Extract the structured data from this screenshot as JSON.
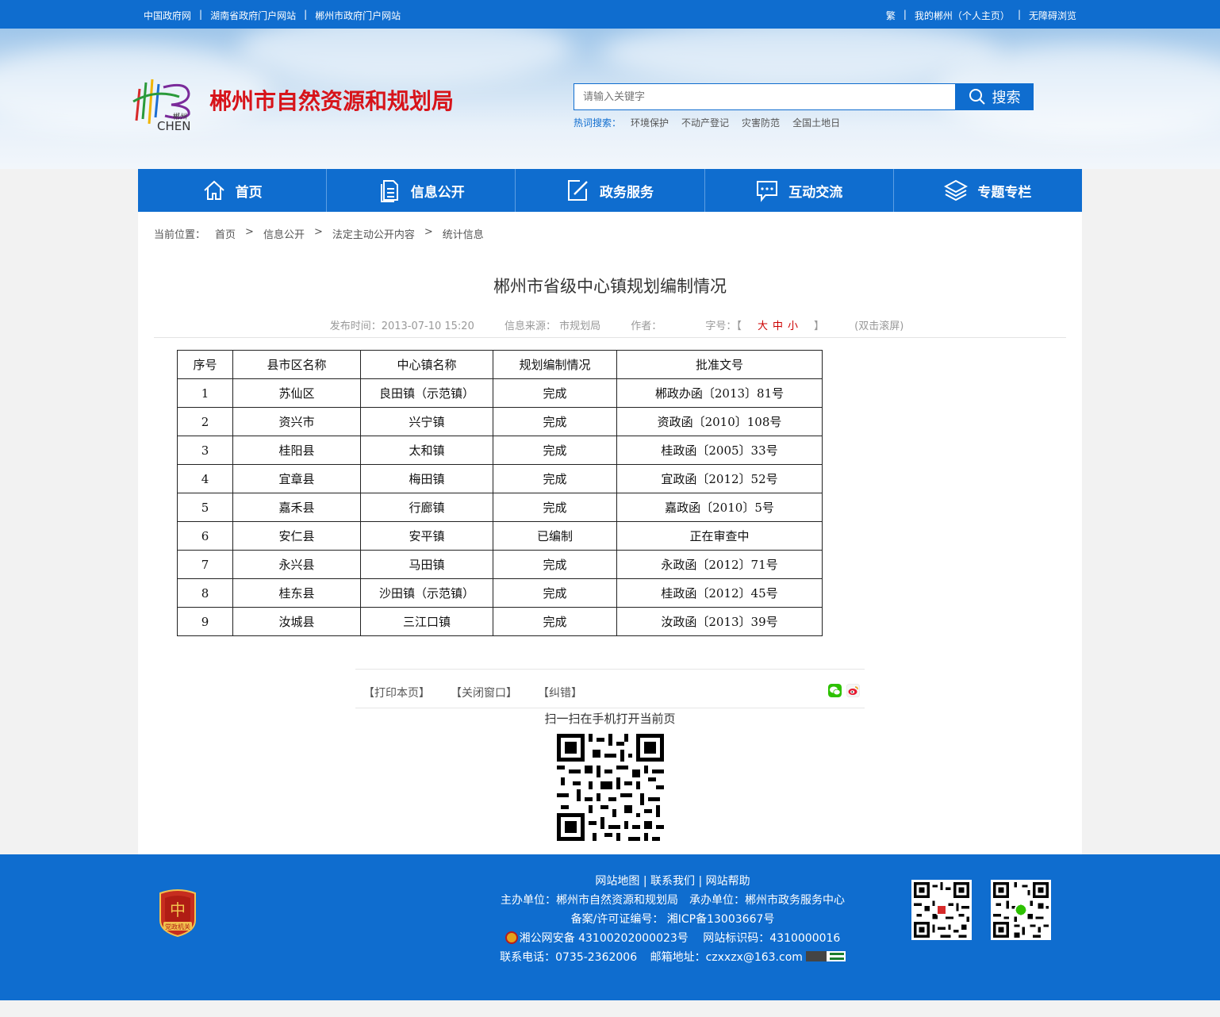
{
  "topbar": {
    "left_links": [
      "中国政府网",
      "湖南省政府门户网站",
      "郴州市政府门户网站"
    ],
    "right_links": [
      "繁",
      "我的郴州（个人主页）",
      "无障碍浏览"
    ],
    "separator": "|"
  },
  "header": {
    "logo_text_cn": "郴州",
    "logo_text_en": "CHEN",
    "site_title": "郴州市自然资源和规划局",
    "search": {
      "placeholder": "请输入关键字",
      "button_label": "搜索"
    },
    "hot_search": {
      "label": "热词搜索：",
      "items": [
        "环境保护",
        "不动产登记",
        "灾害防范",
        "全国土地日"
      ]
    }
  },
  "nav": {
    "items": [
      {
        "label": "首页",
        "icon": "home-icon"
      },
      {
        "label": "信息公开",
        "icon": "document-icon"
      },
      {
        "label": "政务服务",
        "icon": "edit-icon"
      },
      {
        "label": "互动交流",
        "icon": "chat-icon"
      },
      {
        "label": "专题专栏",
        "icon": "layers-icon"
      }
    ]
  },
  "breadcrumb": {
    "prefix": "当前位置：",
    "items": [
      "首页",
      "信息公开",
      "法定主动公开内容",
      "统计信息"
    ],
    "separator": ">"
  },
  "article": {
    "title": "郴州市省级中心镇规划编制情况",
    "publish_time": "发布时间：2013-07-10 15:20",
    "source": "信息来源： 市规划局",
    "author": "作者：",
    "font_size_label": "字号：【",
    "font_sizes": [
      "大",
      "中",
      "小"
    ],
    "font_size_close": "】",
    "scroll_hint": "(双击滚屏)"
  },
  "table": {
    "headers": [
      "序号",
      "县市区名称",
      "中心镇名称",
      "规划编制情况",
      "批准文号"
    ],
    "rows": [
      [
        "1",
        "苏仙区",
        "良田镇（示范镇）",
        "完成",
        "郴政办函〔2013〕81号"
      ],
      [
        "2",
        "资兴市",
        "兴宁镇",
        "完成",
        "资政函〔2010〕108号"
      ],
      [
        "3",
        "桂阳县",
        "太和镇",
        "完成",
        "桂政函〔2005〕33号"
      ],
      [
        "4",
        "宜章县",
        "梅田镇",
        "完成",
        "宜政函〔2012〕52号"
      ],
      [
        "5",
        "嘉禾县",
        "行廊镇",
        "完成",
        "嘉政函〔2010〕5号"
      ],
      [
        "6",
        "安仁县",
        "安平镇",
        "已编制",
        "正在审查中"
      ],
      [
        "7",
        "永兴县",
        "马田镇",
        "完成",
        "永政函〔2012〕71号"
      ],
      [
        "8",
        "桂东县",
        "沙田镇（示范镇）",
        "完成",
        "桂政函〔2012〕45号"
      ],
      [
        "9",
        "汝城县",
        "三江口镇",
        "完成",
        "汝政函〔2013〕39号"
      ]
    ]
  },
  "tools": {
    "print": "【打印本页】",
    "close": "【关闭窗口】",
    "correct": "【纠错】",
    "share_icons": [
      "wechat-icon",
      "weibo-icon"
    ],
    "scan_text": "扫一扫在手机打开当前页"
  },
  "footer": {
    "emblem_text": "党政机关",
    "links": [
      "网站地图",
      "联系我们",
      "网站帮助"
    ],
    "sponsor": "主办单位：郴州市自然资源和规划局　承办单位：郴州市政务服务中心",
    "icp": "备案/许可证编号： 湘ICP备13003667号",
    "police": "湘公网安备 43100202000023号",
    "site_code": "网站标识码：4310000016",
    "phone": "联系电话：0735-2362006",
    "email": "邮箱地址：czxxzx@163.com"
  },
  "colors": {
    "primary_blue": "#0f6dcf",
    "title_red": "#d7141a",
    "font_size_red": "#cc0000"
  }
}
